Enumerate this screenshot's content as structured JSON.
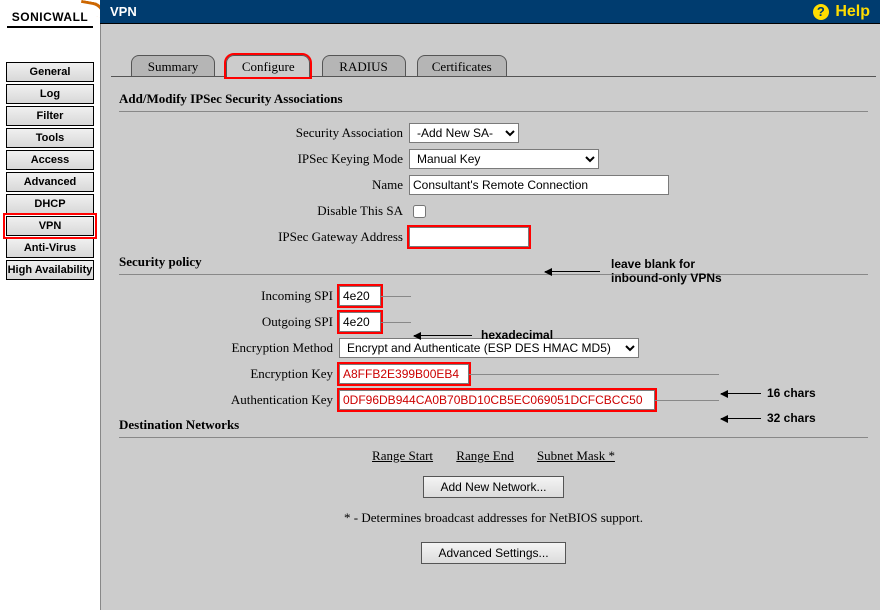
{
  "header": {
    "title": "VPN",
    "help_label": "Help"
  },
  "logo": {
    "text": "SONICWALL"
  },
  "sidebar": {
    "items": [
      {
        "label": "General",
        "active": false
      },
      {
        "label": "Log",
        "active": false
      },
      {
        "label": "Filter",
        "active": false
      },
      {
        "label": "Tools",
        "active": false
      },
      {
        "label": "Access",
        "active": false
      },
      {
        "label": "Advanced",
        "active": false
      },
      {
        "label": "DHCP",
        "active": false
      },
      {
        "label": "VPN",
        "active": true
      },
      {
        "label": "Anti-Virus",
        "active": false
      },
      {
        "label": "High Availability",
        "active": false
      }
    ]
  },
  "tabs": [
    {
      "label": "Summary",
      "active": false
    },
    {
      "label": "Configure",
      "active": true
    },
    {
      "label": "RADIUS",
      "active": false
    },
    {
      "label": "Certificates",
      "active": false
    }
  ],
  "sections": {
    "add_modify": "Add/Modify IPSec Security Associations",
    "security_policy": "Security policy",
    "destination": "Destination Networks"
  },
  "form": {
    "sa_label": "Security Association",
    "sa_value": "-Add New SA-",
    "keying_label": "IPSec Keying Mode",
    "keying_value": "Manual Key",
    "name_label": "Name",
    "name_value": "Consultant's Remote Connection",
    "disable_label": "Disable This SA",
    "gateway_label": "IPSec Gateway Address",
    "gateway_value": "",
    "in_spi_label": "Incoming SPI",
    "in_spi_value": "4e20",
    "out_spi_label": "Outgoing SPI",
    "out_spi_value": "4e20",
    "enc_method_label": "Encryption Method",
    "enc_method_value": "Encrypt and Authenticate (ESP DES HMAC MD5)",
    "enc_key_label": "Encryption Key",
    "enc_key_value": "A8FFB2E399B00EB4",
    "auth_key_label": "Authentication Key",
    "auth_key_value": "0DF96DB944CA0B70BD10CB5EC069051DCFCBCC50"
  },
  "dest": {
    "col_range_start": "Range Start",
    "col_range_end": "Range End",
    "col_subnet": "Subnet Mask *",
    "add_btn": "Add New Network...",
    "note": "* - Determines broadcast addresses for NetBIOS support.",
    "adv_btn": "Advanced Settings..."
  },
  "annotations": {
    "gateway_note": "leave blank for\ninbound-only VPNs",
    "spi_note": "hexadecimal",
    "enc_key_note": "16 chars",
    "auth_key_note": "32 chars"
  }
}
